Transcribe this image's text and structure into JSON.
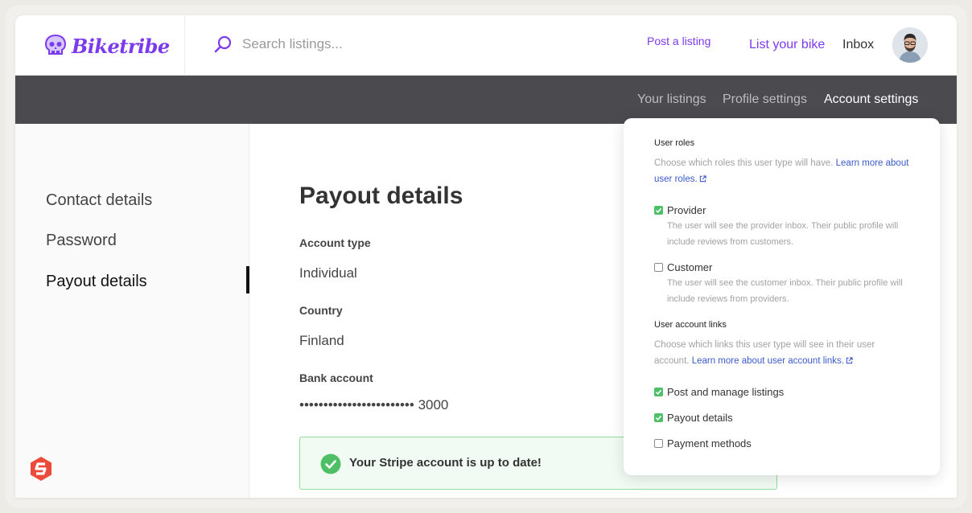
{
  "brand": {
    "name": "Biketribe",
    "color": "#7c3aed"
  },
  "search": {
    "placeholder": "Search listings..."
  },
  "topnav": {
    "post": "Post a listing",
    "list": "List your bike",
    "inbox": "Inbox"
  },
  "subnav": {
    "tabs": [
      "Your listings",
      "Profile settings",
      "Account settings"
    ],
    "active": "Account settings"
  },
  "sidebar": {
    "items": [
      "Contact details",
      "Password",
      "Payout details"
    ],
    "active": "Payout details"
  },
  "main": {
    "title": "Payout details",
    "account_type_label": "Account type",
    "account_type_value": "Individual",
    "country_label": "Country",
    "country_value": "Finland",
    "bank_label": "Bank account",
    "bank_value": "•••••••••••••••••••••••• 3000",
    "notice": "Your Stripe account is up to date!"
  },
  "popup": {
    "roles_heading": "User roles",
    "roles_desc": "Choose which roles this user type will have.",
    "roles_link": "Learn more about user roles.",
    "provider": {
      "label": "Provider",
      "checked": true,
      "sub": "The user will see the provider inbox. Their public profile will include reviews from customers."
    },
    "customer": {
      "label": "Customer",
      "checked": false,
      "sub": "The user will see the customer inbox. Their public profile will include reviews from providers."
    },
    "links_heading": "User account links",
    "links_desc": "Choose which links this user type will see in their user account.",
    "links_link": "Learn more about user account links.",
    "options": [
      {
        "label": "Post and manage listings",
        "checked": true
      },
      {
        "label": "Payout details",
        "checked": true
      },
      {
        "label": "Payment methods",
        "checked": false
      }
    ]
  },
  "colors": {
    "accent": "#7c3aed",
    "dark_nav": "#4a4a4f",
    "success": "#4fbf67",
    "link": "#3b5bcc"
  }
}
